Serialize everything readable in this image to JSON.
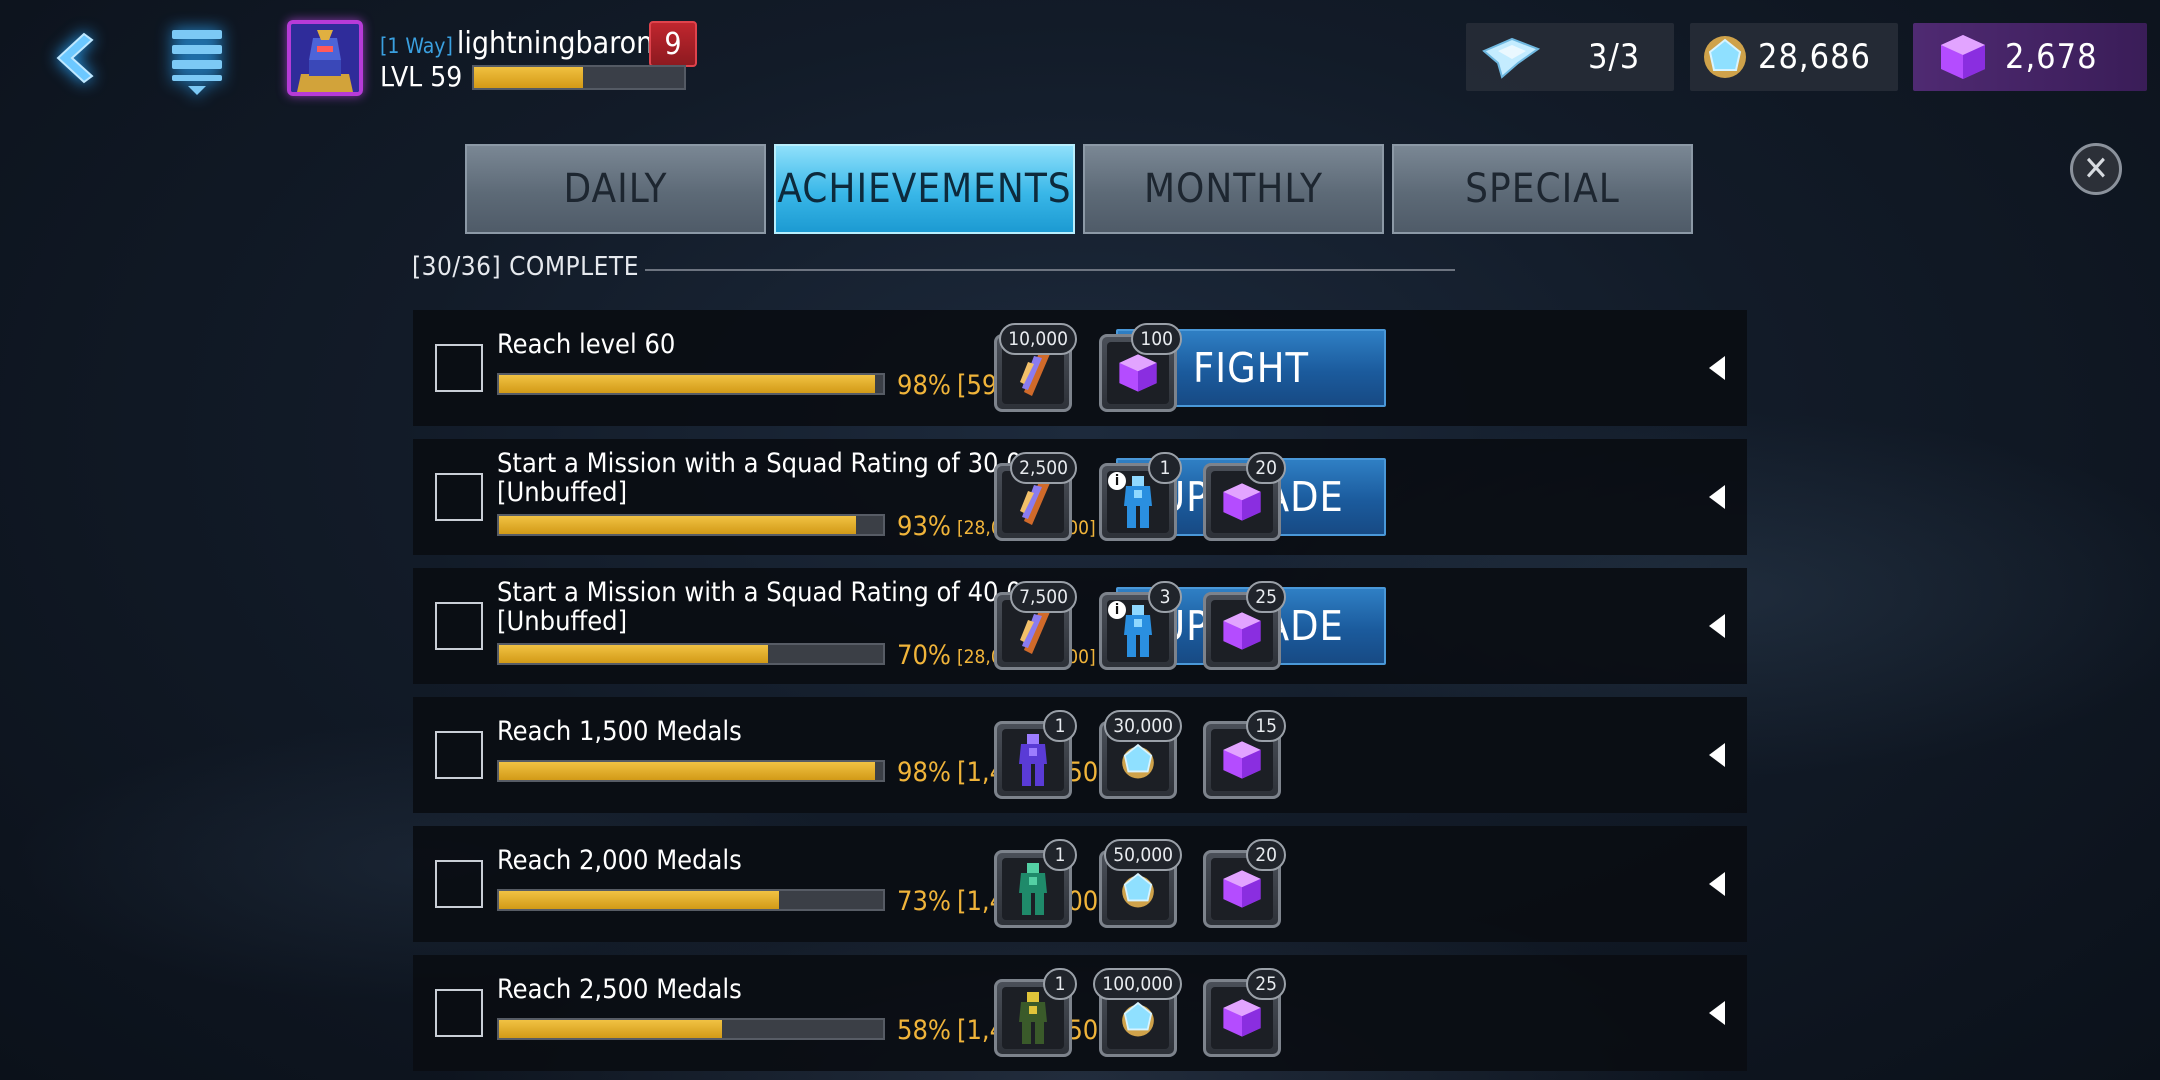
{
  "header": {
    "guild_tag": "[1 Way]",
    "player_name": "lightningbaron",
    "vip_level": "9",
    "level_label": "LVL 59",
    "xp_progress": 0.52
  },
  "currencies": {
    "energy": {
      "value": "3/3",
      "icon": "energy-crystal-icon"
    },
    "credits": {
      "value": "28,686",
      "icon": "credits-icon"
    },
    "crystals": {
      "value": "2,678",
      "icon": "purple-cube-icon"
    }
  },
  "tabs": [
    {
      "label": "DAILY",
      "active": false
    },
    {
      "label": "ACHIEVEMENTS",
      "active": true
    },
    {
      "label": "MONTHLY",
      "active": false
    },
    {
      "label": "SPECIAL",
      "active": false
    }
  ],
  "complete_label": "[30/36] COMPLETE",
  "achievements": [
    {
      "title": "Reach level 60",
      "progress": 0.98,
      "percent": "98%",
      "fraction": "[59/60]",
      "action": "FIGHT",
      "rewards": [
        {
          "icon": "orange-feather-icon",
          "count": "10,000"
        },
        {
          "icon": "purple-cube-icon",
          "count": "100"
        }
      ]
    },
    {
      "title": "Start a Mission with a Squad Rating of 30,000 [Unbuffed]",
      "progress": 0.93,
      "percent": "93%",
      "fraction": "[28,024/30,000]",
      "action": "UPGRADE",
      "rewards": [
        {
          "icon": "orange-feather-icon",
          "count": "2,500"
        },
        {
          "icon": "blue-robot-figure-icon",
          "count": "1",
          "info": "i"
        },
        {
          "icon": "purple-cube-icon",
          "count": "20"
        }
      ]
    },
    {
      "title": "Start a Mission with a Squad Rating of 40,000 [Unbuffed]",
      "progress": 0.7,
      "percent": "70%",
      "fraction": "[28,024/40,000]",
      "action": "UPGRADE",
      "rewards": [
        {
          "icon": "orange-feather-icon",
          "count": "7,500"
        },
        {
          "icon": "blue-robot-figure-icon",
          "count": "3",
          "info": "i"
        },
        {
          "icon": "purple-cube-icon",
          "count": "25"
        }
      ]
    },
    {
      "title": "Reach 1,500 Medals",
      "progress": 0.98,
      "percent": "98%",
      "fraction": "[1,473/1,500]",
      "action": "",
      "rewards": [
        {
          "icon": "purple-robot-figure-icon",
          "count": "1"
        },
        {
          "icon": "credits-icon",
          "count": "30,000"
        },
        {
          "icon": "purple-cube-icon",
          "count": "15"
        }
      ]
    },
    {
      "title": "Reach 2,000 Medals",
      "progress": 0.73,
      "percent": "73%",
      "fraction": "[1,473/2,000]",
      "action": "",
      "rewards": [
        {
          "icon": "teal-robot-figure-icon",
          "count": "1"
        },
        {
          "icon": "credits-icon",
          "count": "50,000"
        },
        {
          "icon": "purple-cube-icon",
          "count": "20"
        }
      ]
    },
    {
      "title": "Reach 2,500 Medals",
      "progress": 0.58,
      "percent": "58%",
      "fraction": "[1,473/2,500]",
      "action": "",
      "rewards": [
        {
          "icon": "yellow-robot-figure-icon",
          "count": "1"
        },
        {
          "icon": "credits-icon",
          "count": "100,000"
        },
        {
          "icon": "purple-cube-icon",
          "count": "25"
        }
      ]
    }
  ]
}
